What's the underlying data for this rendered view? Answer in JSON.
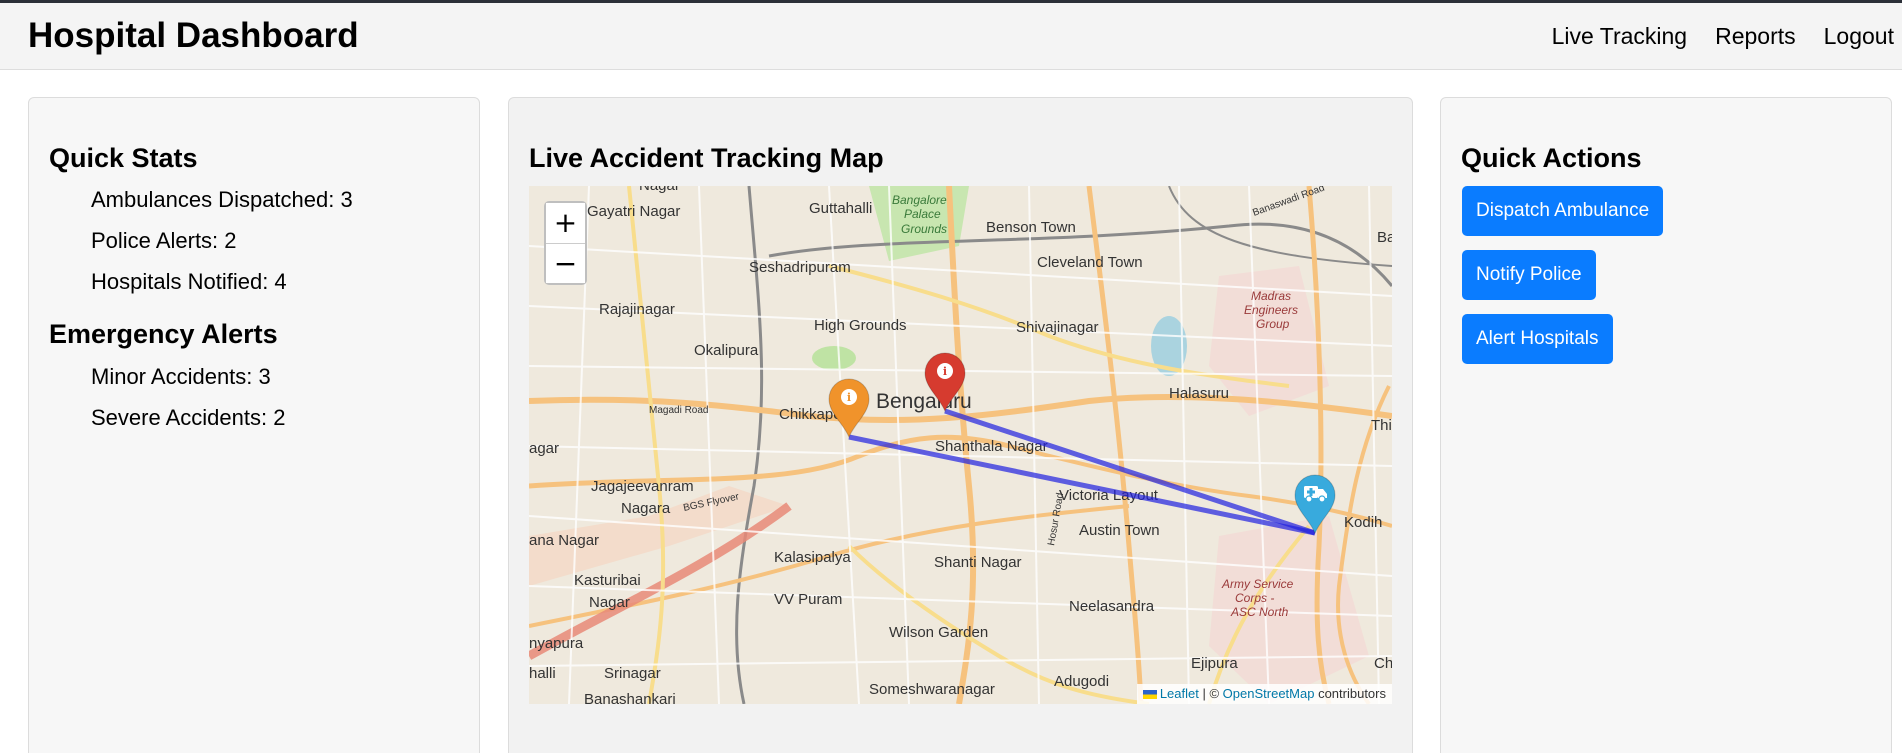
{
  "header": {
    "title": "Hospital Dashboard",
    "nav": [
      "Live Tracking",
      "Reports",
      "Logout"
    ]
  },
  "quick_stats": {
    "title": "Quick Stats",
    "items": [
      "Ambulances Dispatched: 3",
      "Police Alerts: 2",
      "Hospitals Notified: 4"
    ]
  },
  "emergency_alerts": {
    "title": "Emergency Alerts",
    "items": [
      "Minor Accidents: 3",
      "Severe Accidents: 2"
    ]
  },
  "map": {
    "title": "Live Accident Tracking Map",
    "zoom_in": "+",
    "zoom_out": "−",
    "attribution": {
      "leaflet": "Leaflet",
      "separator": " | © ",
      "osm": "OpenStreetMap",
      "suffix": " contributors"
    },
    "labels": [
      "Nagar",
      "Gayatri Nagar",
      "Guttahalli",
      "Bangalore",
      "Palace",
      "Grounds",
      "Benson Town",
      "Seshadripuram",
      "Cleveland Town",
      "Rajajinagar",
      "High Grounds",
      "Shivajinagar",
      "Madras",
      "Engineers",
      "Group",
      "Okalipura",
      "Bengaluru",
      "Halasuru",
      "Magadi Road",
      "Chikkapete",
      "Shanthala Nagar",
      "Thip",
      "agar",
      "Jagajeevanram",
      "Nagara",
      "Victoria Layout",
      "BGS Flyover",
      "Austin Town",
      "Kodih",
      "ana Nagar",
      "Kalasipalya",
      "Shanti Nagar",
      "Kasturibai",
      "Nagar",
      "Hosur Road",
      "Army Service",
      "Corps -",
      "ASC North",
      "VV Puram",
      "Neelasandra",
      "Wilson Garden",
      "nyapura",
      "Ejipura",
      "halli",
      "Srinagar",
      "Adugodi",
      "Cha",
      "Banashankari",
      "Someshwaranagar",
      "Bai",
      "Banaswadi Road"
    ],
    "markers": [
      {
        "name": "accident-minor",
        "color": "#f0932b"
      },
      {
        "name": "accident-severe",
        "color": "#d63b2f"
      },
      {
        "name": "ambulance",
        "color": "#38aadd"
      }
    ],
    "route_color": "#2020e0"
  },
  "quick_actions": {
    "title": "Quick Actions",
    "buttons": [
      "Dispatch Ambulance",
      "Notify Police",
      "Alert Hospitals"
    ],
    "button_color": "#0a7cff"
  }
}
